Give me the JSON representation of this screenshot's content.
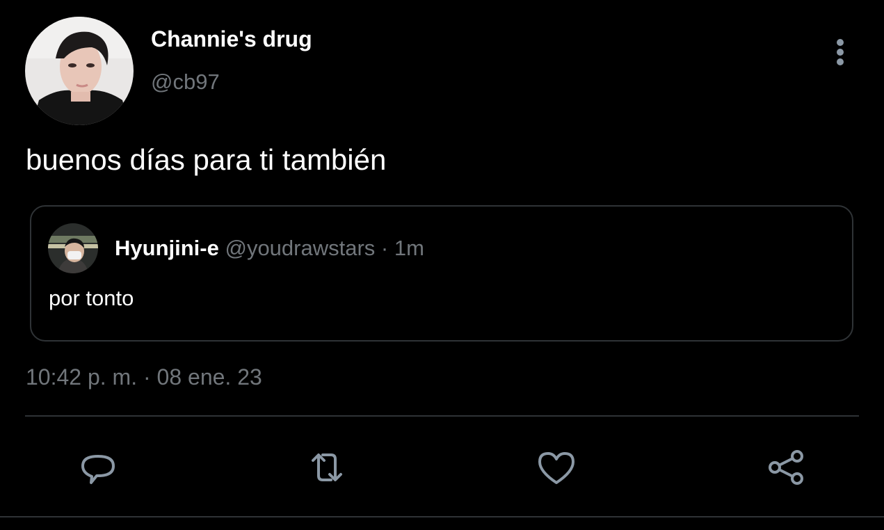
{
  "tweet": {
    "author": {
      "display_name": "Channie's drug",
      "handle": "@cb97"
    },
    "text": "buenos días para ti también",
    "quoted": {
      "display_name": "Hyunjini-e",
      "handle": "@youdrawstars",
      "separator": " · ",
      "age": "1m",
      "text": "por tonto"
    },
    "timestamp": "10:42 p. m. · 08 ene. 23"
  },
  "icons": {
    "more": "vertical-ellipsis-icon",
    "reply": "speech-bubble-icon",
    "retweet": "retweet-arrows-icon",
    "like": "heart-icon",
    "share": "share-nodes-icon"
  },
  "colors": {
    "background": "#000000",
    "text_primary": "#ffffff",
    "text_secondary": "#71767b",
    "border": "#2f3336",
    "icon": "#8b98a5"
  }
}
